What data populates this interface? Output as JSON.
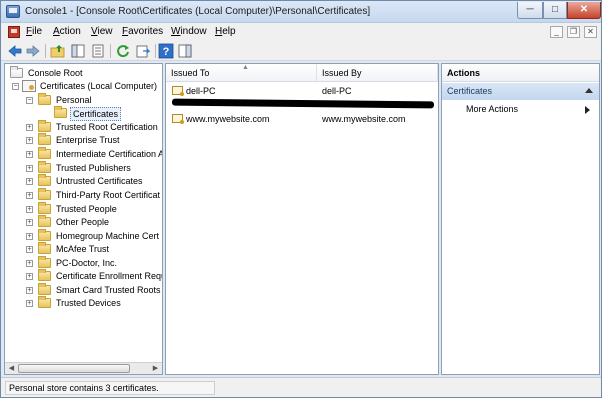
{
  "window": {
    "title": "Console1 - [Console Root\\Certificates (Local Computer)\\Personal\\Certificates]",
    "minimize_glyph": "─",
    "maximize_glyph": "□",
    "close_glyph": "✕"
  },
  "menu": {
    "items": [
      "File",
      "Action",
      "View",
      "Favorites",
      "Window",
      "Help"
    ],
    "mdi_minimize": "_",
    "mdi_restore": "❐",
    "mdi_close": "✕"
  },
  "toolbar": {
    "buttons": [
      "back-icon",
      "forward-icon",
      "up-folder-icon",
      "show-hide-tree-icon",
      "properties-icon",
      "refresh-icon",
      "export-list-icon",
      "help-icon",
      "show-hide-action-pane-icon"
    ]
  },
  "tree": {
    "root": "Console Root",
    "certificates": "Certificates (Local Computer)",
    "personal": "Personal",
    "personal_certificates": "Certificates",
    "stores": [
      "Trusted Root Certification",
      "Enterprise Trust",
      "Intermediate Certification A",
      "Trusted Publishers",
      "Untrusted Certificates",
      "Third-Party Root Certificat",
      "Trusted People",
      "Other People",
      "Homegroup Machine Cert",
      "McAfee Trust",
      "PC-Doctor, Inc.",
      "Certificate Enrollment Requ",
      "Smart Card Trusted Roots",
      "Trusted Devices"
    ],
    "expand_glyph": "+",
    "collapse_glyph": "−",
    "scroll_left": "◀",
    "scroll_right": "▶"
  },
  "list": {
    "columns": [
      "Issued To",
      "Issued By"
    ],
    "sort_glyph": "▲",
    "rows": [
      {
        "issued_to": "dell-PC",
        "issued_by": "dell-PC"
      },
      {
        "issued_to": "www.mywebsite.com",
        "issued_by": "www.mywebsite.com"
      }
    ]
  },
  "actions": {
    "header": "Actions",
    "section": "Certificates",
    "items": [
      "More Actions"
    ]
  },
  "status": {
    "text": "Personal store contains 3 certificates."
  },
  "colors": {
    "title_gradient_top": "#dbe8f7",
    "selection": "#e8f1fb",
    "actions_section": "#c5d7ee",
    "close_button": "#c7432a"
  }
}
